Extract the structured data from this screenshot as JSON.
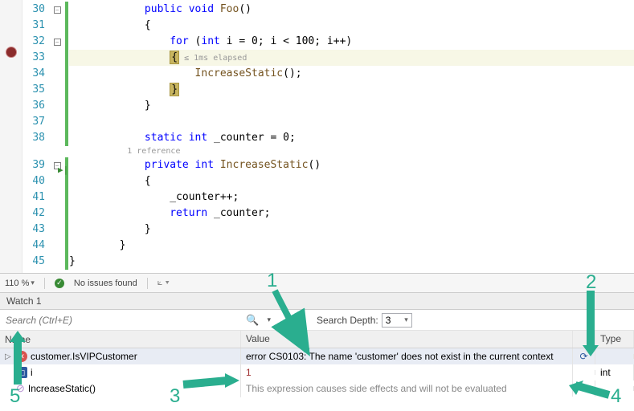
{
  "editor": {
    "line_numbers": [
      "30",
      "31",
      "32",
      "33",
      "34",
      "35",
      "36",
      "37",
      "38",
      "",
      "39",
      "40",
      "41",
      "42",
      "43",
      "44",
      "45"
    ],
    "code": {
      "l30": {
        "indent": "            ",
        "kw1": "public",
        "sp1": " ",
        "kw2": "void",
        "sp2": " ",
        "name": "Foo",
        "after": "()"
      },
      "l31": "            {",
      "l32": {
        "indent": "                ",
        "kw": "for",
        "open": " (",
        "tp": "int",
        "rest": " i = 0; i < 100; i++)"
      },
      "l33": {
        "indent": "                ",
        "brace": "{",
        "hint": " ≤ 1ms elapsed"
      },
      "l34": {
        "indent": "                    ",
        "call": "IncreaseStatic",
        "after": "();"
      },
      "l35": {
        "indent": "                ",
        "brace": "}"
      },
      "l36": "            }",
      "l37": "",
      "l38": {
        "indent": "            ",
        "kw1": "static",
        "sp1": " ",
        "tp": "int",
        "rest": " _counter = 0;"
      },
      "lens": "            1 reference",
      "l39": {
        "indent": "            ",
        "kw1": "private",
        "sp1": " ",
        "tp": "int",
        "sp2": " ",
        "name": "IncreaseStatic",
        "after": "()"
      },
      "l40": "            {",
      "l41": "                _counter++;",
      "l42": {
        "indent": "                ",
        "kw": "return",
        "rest": " _counter;"
      },
      "l43": "            }",
      "l44": "        }",
      "l45": "}"
    }
  },
  "statusbar": {
    "zoom": "110 %",
    "issues": "No issues found"
  },
  "watch": {
    "title": "Watch 1",
    "search_placeholder": "Search (Ctrl+E)",
    "depth_label": "Search Depth:",
    "depth_value": "3",
    "columns": {
      "name": "Name",
      "value": "Value",
      "type": "Type"
    },
    "rows": [
      {
        "icon": "error",
        "name": "customer.IsVIPCustomer",
        "value": "error CS0103: The name 'customer' does not exist in the current context",
        "refresh": true,
        "type": "",
        "selected": true
      },
      {
        "icon": "var",
        "name": "i",
        "value": "1",
        "value_class": "num",
        "refresh": false,
        "type": "int"
      },
      {
        "icon": "side",
        "name": "IncreaseStatic()",
        "value": "This expression causes side effects and will not be evaluated",
        "value_class": "gray",
        "refresh": true,
        "type": ""
      }
    ]
  },
  "annotations": {
    "n1": "1",
    "n2": "2",
    "n3": "3",
    "n4": "4",
    "n5": "5"
  }
}
